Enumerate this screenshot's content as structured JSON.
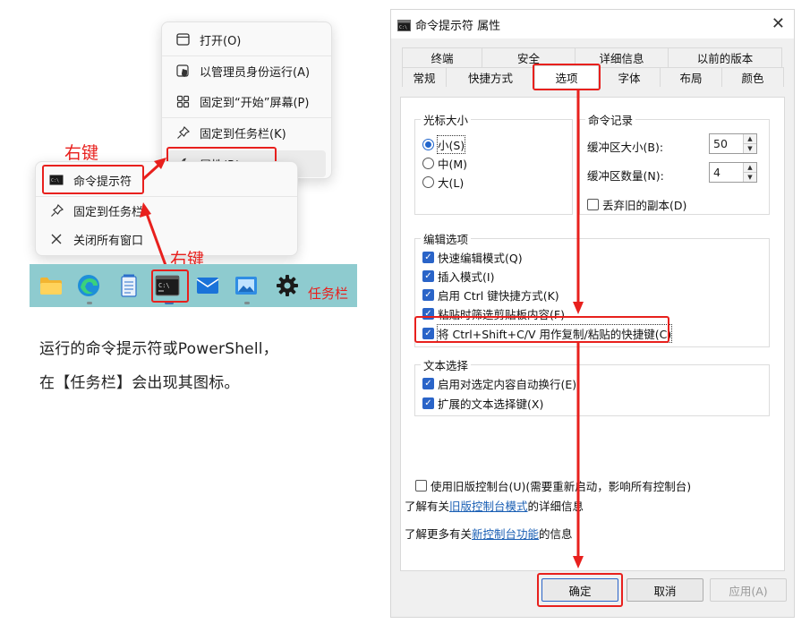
{
  "annotations": {
    "right_click_1": "右键",
    "right_click_2": "右键",
    "taskbar_label": "任务栏"
  },
  "context_menu_small": {
    "items": [
      {
        "label": "命令提示符",
        "icon": "cmd-icon"
      },
      {
        "label": "固定到任务栏",
        "icon": "pin-icon"
      },
      {
        "label": "关闭所有窗口",
        "icon": "close-icon"
      }
    ]
  },
  "context_menu_large": {
    "items": [
      {
        "label": "打开(O)",
        "icon": "window-icon"
      },
      {
        "label": "以管理员身份运行(A)",
        "icon": "shield-icon"
      },
      {
        "label": "固定到“开始”屏幕(P)",
        "icon": "start-grid-icon"
      },
      {
        "label": "固定到任务栏(K)",
        "icon": "pin-icon"
      },
      {
        "label": "属性(R)",
        "icon": "wrench-icon"
      }
    ]
  },
  "taskbar": {
    "icons": [
      "folder-icon",
      "edge-icon",
      "notepad-icon",
      "terminal-icon",
      "mail-icon",
      "photos-icon",
      "settings-icon"
    ]
  },
  "caption": {
    "line1": "运行的命令提示符或PowerShell，",
    "line2": "在【任务栏】会出现其图标。"
  },
  "dialog": {
    "title": "命令提示符 属性",
    "tabs_row1": [
      "终端",
      "安全",
      "详细信息",
      "以前的版本"
    ],
    "tabs_row2": [
      "常规",
      "快捷方式",
      "选项",
      "字体",
      "布局",
      "颜色"
    ],
    "active_tab": "选项",
    "cursor_size": {
      "label": "光标大小",
      "options": [
        {
          "label": "小(S)",
          "selected": true
        },
        {
          "label": "中(M)",
          "selected": false
        },
        {
          "label": "大(L)",
          "selected": false
        }
      ]
    },
    "history": {
      "label": "命令记录",
      "buffer_size_label": "缓冲区大小(B):",
      "buffer_size_value": "50",
      "buffer_count_label": "缓冲区数量(N):",
      "buffer_count_value": "4",
      "discard_label": "丢弃旧的副本(D)",
      "discard_checked": false
    },
    "edit_options": {
      "label": "编辑选项",
      "items": [
        {
          "label": "快速编辑模式(Q)",
          "checked": true
        },
        {
          "label": "插入模式(I)",
          "checked": true
        },
        {
          "label": "启用 Ctrl 键快捷方式(K)",
          "checked": true
        },
        {
          "label": "粘贴时筛选剪贴板内容(F)",
          "checked": true
        },
        {
          "label": "将 Ctrl+Shift+C/V 用作复制/粘贴的快捷键(C)",
          "checked": true
        }
      ]
    },
    "text_select": {
      "label": "文本选择",
      "items": [
        {
          "label": "启用对选定内容自动换行(E)",
          "checked": true
        },
        {
          "label": "扩展的文本选择键(X)",
          "checked": true
        }
      ]
    },
    "legacy": {
      "checkbox_label": "使用旧版控制台(U)(需要重新启动，影响所有控制台)",
      "checked": false,
      "info1_prefix": "了解有关",
      "info1_link": "旧版控制台模式",
      "info1_suffix": "的详细信息",
      "info2_prefix": "了解更多有关",
      "info2_link": "新控制台功能",
      "info2_suffix": "的信息"
    },
    "buttons": {
      "ok": "确定",
      "cancel": "取消",
      "apply": "应用(A)"
    }
  },
  "colors": {
    "highlight_red": "#e8201d",
    "accent_blue": "#2a64c8",
    "taskbar_bg": "#8ecbcf"
  }
}
